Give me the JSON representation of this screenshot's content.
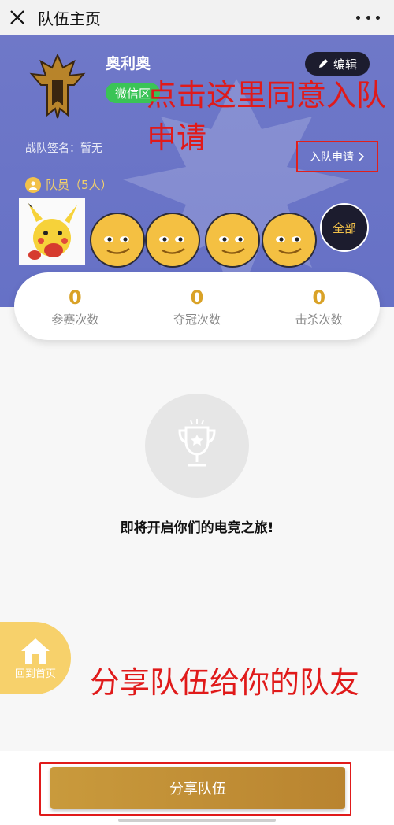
{
  "topbar": {
    "title": "队伍主页"
  },
  "team": {
    "name": "奥利奥",
    "region": "微信区",
    "edit_label": "编辑",
    "signature": "战队签名：暂无",
    "join_request_label": "入队申请",
    "members_label": "队员（5人）",
    "all_label": "全部"
  },
  "annotations": {
    "join_hint": "点击这里同意入队申请",
    "share_hint": "分享队伍给你的队友"
  },
  "stats": [
    {
      "value": "0",
      "label": "参赛次数"
    },
    {
      "value": "0",
      "label": "夺冠次数"
    },
    {
      "value": "0",
      "label": "击杀次数"
    }
  ],
  "empty_state": {
    "text": "即将开启你们的电竞之旅!"
  },
  "home_button": {
    "label": "回到首页"
  },
  "share_button": {
    "label": "分享队伍"
  },
  "colors": {
    "hero": "#6f78c8",
    "accent_gold": "#d9a227",
    "annotation_red": "#e01a1a",
    "region_green": "#3ac456"
  }
}
